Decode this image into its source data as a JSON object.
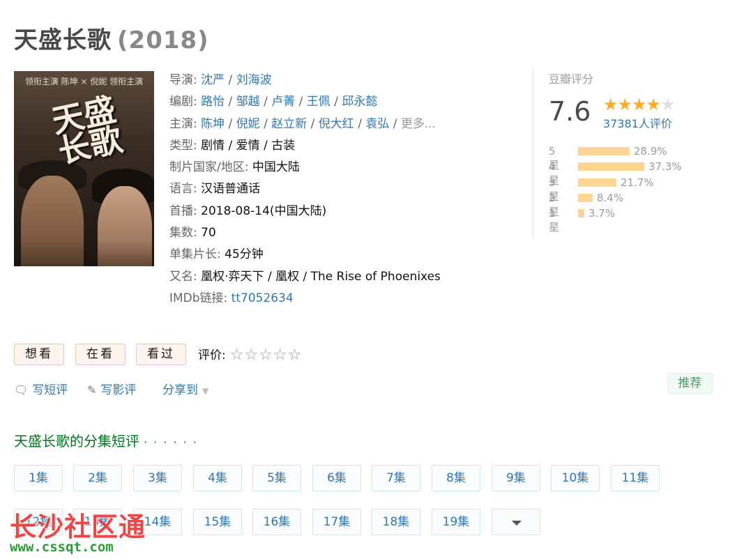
{
  "header": {
    "title": "天盛长歌",
    "year": "(2018)"
  },
  "info": {
    "director_label": "导演:",
    "directors": [
      "沈严",
      "刘海波"
    ],
    "writer_label": "编剧:",
    "writers": [
      "路怡",
      "邹越",
      "卢菁",
      "王佩",
      "邱永懿"
    ],
    "cast_label": "主演:",
    "cast": [
      "陈坤",
      "倪妮",
      "赵立新",
      "倪大红",
      "袁弘"
    ],
    "cast_more": "更多...",
    "genre_label": "类型:",
    "genre": "剧情 / 爱情 / 古装",
    "country_label": "制片国家/地区:",
    "country": "中国大陆",
    "language_label": "语言:",
    "language": "汉语普通话",
    "premiere_label": "首播:",
    "premiere": "2018-08-14(中国大陆)",
    "episodes_label": "集数:",
    "episodes": "70",
    "runtime_label": "单集片长:",
    "runtime": "45分钟",
    "aka_label": "又名:",
    "aka": "凰权·弈天下 / 凰权 / The Rise of Phoenixes",
    "imdb_label": "IMDb链接:",
    "imdb": "tt7052634"
  },
  "poster": {
    "caption": "领衔主演 陈坤 × 倪妮 领衔主演",
    "calligraphy": "天盛长歌"
  },
  "rating": {
    "title": "豆瓣评分",
    "score": "7.6",
    "stars_filled": 4,
    "stars_total": 5,
    "count": "37381人评价",
    "distribution": [
      {
        "label": "5星",
        "percent": 28.9,
        "text": "28.9%"
      },
      {
        "label": "4星",
        "percent": 37.3,
        "text": "37.3%"
      },
      {
        "label": "3星",
        "percent": 21.7,
        "text": "21.7%"
      },
      {
        "label": "2星",
        "percent": 8.4,
        "text": "8.4%"
      },
      {
        "label": "1星",
        "percent": 3.7,
        "text": "3.7%"
      }
    ]
  },
  "actions": {
    "want": "想看",
    "watching": "在看",
    "watched": "看过",
    "rate_label": "评价:",
    "rate_stars": "☆☆☆☆☆"
  },
  "links": {
    "short_review": "写短评",
    "review": "写影评",
    "share": "分享到"
  },
  "recommend": "推荐",
  "episodes_section": {
    "title": "天盛长歌的分集短评",
    "dots": "· · · · · ·",
    "row1": [
      "1集",
      "2集",
      "3集",
      "4集",
      "5集",
      "6集",
      "7集",
      "8集",
      "9集",
      "10集",
      "11集"
    ],
    "row2": [
      "12集",
      "13集",
      "14集",
      "15集",
      "16集",
      "17集",
      "18集",
      "19集"
    ]
  },
  "watermark": {
    "name": "长沙社区通",
    "url": "www.cssqt.com"
  },
  "colors": {
    "link": "#3377aa",
    "star": "#ffac2d",
    "bar": "#ffd596",
    "green": "#007722",
    "watermark_red": "#e8393a"
  }
}
